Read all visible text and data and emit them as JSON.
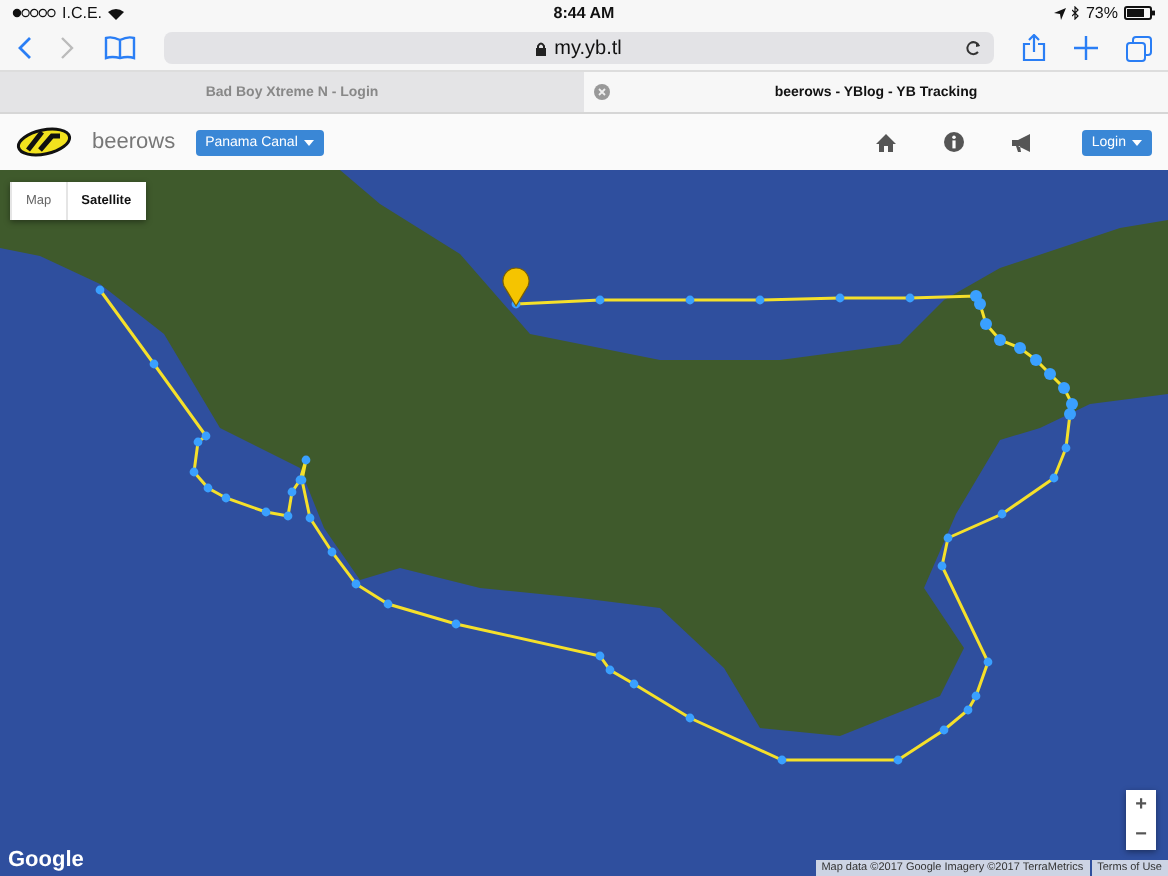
{
  "status_bar": {
    "carrier": "I.C.E.",
    "time": "8:44 AM",
    "battery": "73%"
  },
  "browser": {
    "url": "my.yb.tl",
    "tabs": [
      {
        "title": "Bad Boy Xtreme N - Login",
        "selected": false
      },
      {
        "title": "beerows - YBlog - YB Tracking",
        "selected": true
      }
    ]
  },
  "app": {
    "name": "beerows",
    "race_menu": "Panama Canal",
    "login": "Login"
  },
  "map": {
    "type_toggle": [
      {
        "label": "Map",
        "selected": false
      },
      {
        "label": "Satellite",
        "selected": true
      }
    ],
    "zoom_in": "+",
    "zoom_out": "−",
    "logo": "Google",
    "attribution": "Map data ©2017 Google Imagery ©2017 TerraMetrics",
    "terms": "Terms of Use"
  }
}
